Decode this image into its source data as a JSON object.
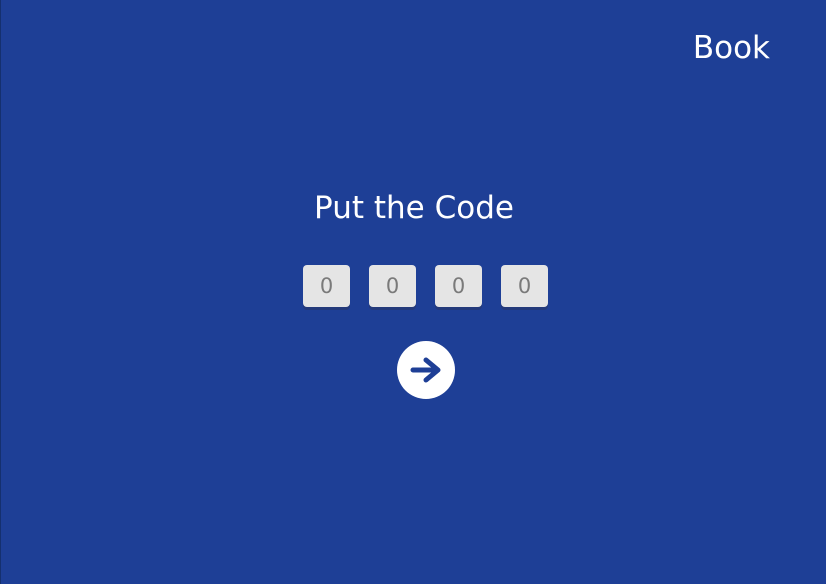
{
  "header": {
    "book_label": "Book"
  },
  "main": {
    "title": "Put the Code",
    "code_digits": [
      {
        "placeholder": "0"
      },
      {
        "placeholder": "0"
      },
      {
        "placeholder": "0"
      },
      {
        "placeholder": "0"
      }
    ],
    "submit_icon": "arrow-right-icon"
  },
  "colors": {
    "background": "#1e3f96",
    "text": "#ffffff",
    "input_background": "#e5e5e5",
    "input_text": "#7a7a7a",
    "button_background": "#ffffff",
    "button_icon": "#1e3f96"
  }
}
